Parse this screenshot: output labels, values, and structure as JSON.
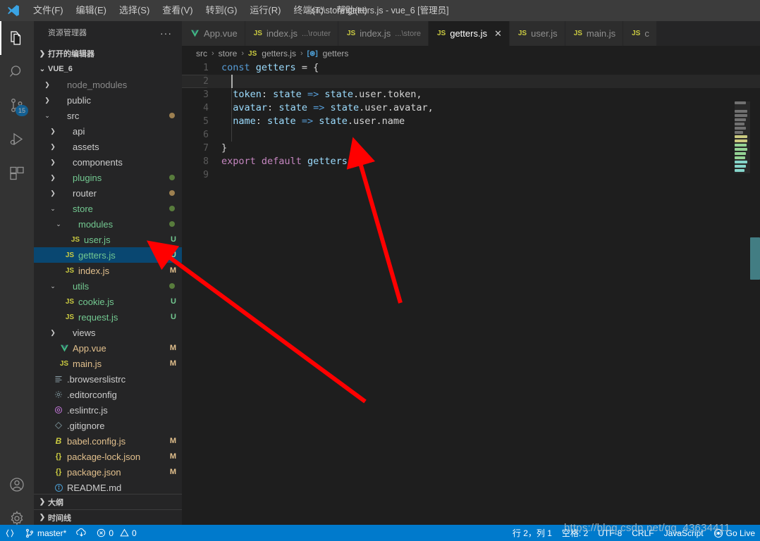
{
  "window": {
    "title": "src\\store\\getters.js - vue_6 [管理员]",
    "logo_icon": "vscode-logo"
  },
  "menu": {
    "items": [
      {
        "label": "文件(F)",
        "name": "menu-file"
      },
      {
        "label": "编辑(E)",
        "name": "menu-edit"
      },
      {
        "label": "选择(S)",
        "name": "menu-selection"
      },
      {
        "label": "查看(V)",
        "name": "menu-view"
      },
      {
        "label": "转到(G)",
        "name": "menu-goto"
      },
      {
        "label": "运行(R)",
        "name": "menu-run"
      },
      {
        "label": "终端(T)",
        "name": "menu-terminal"
      },
      {
        "label": "帮助(H)",
        "name": "menu-help"
      }
    ]
  },
  "activitybar": {
    "items": [
      {
        "icon": "files-explorer-icon",
        "active": true,
        "badge": ""
      },
      {
        "icon": "search-icon",
        "active": false,
        "badge": ""
      },
      {
        "icon": "source-control-icon",
        "active": false,
        "badge": "15"
      },
      {
        "icon": "run-debug-icon",
        "active": false,
        "badge": ""
      },
      {
        "icon": "extensions-icon",
        "active": false,
        "badge": ""
      }
    ],
    "bottom": [
      {
        "icon": "account-icon"
      },
      {
        "icon": "gear-icon"
      }
    ]
  },
  "sidebar": {
    "title": "资源管理器",
    "more_actions": "···",
    "open_editors_label": "打开的编辑器",
    "project_label": "VUE_6",
    "outline_label": "大纲",
    "timeline_label": "时间线",
    "tree": [
      {
        "label": "node_modules",
        "type": "folder",
        "depth": 1,
        "expanded": false,
        "badge": "",
        "dot": "",
        "color": "#8a8a8a"
      },
      {
        "label": "public",
        "type": "folder",
        "depth": 1,
        "expanded": false,
        "badge": "",
        "dot": "",
        "color": "#cccccc"
      },
      {
        "label": "src",
        "type": "folder",
        "depth": 1,
        "expanded": true,
        "badge": "",
        "dot": "#9d8050",
        "color": "#cccccc"
      },
      {
        "label": "api",
        "type": "folder",
        "depth": 2,
        "expanded": false,
        "badge": "",
        "dot": "",
        "color": "#cccccc"
      },
      {
        "label": "assets",
        "type": "folder",
        "depth": 2,
        "expanded": false,
        "badge": "",
        "dot": "",
        "color": "#cccccc"
      },
      {
        "label": "components",
        "type": "folder",
        "depth": 2,
        "expanded": false,
        "badge": "",
        "dot": "",
        "color": "#cccccc"
      },
      {
        "label": "plugins",
        "type": "folder",
        "depth": 2,
        "expanded": false,
        "badge": "",
        "dot": "#587c3c",
        "color": "#73c991"
      },
      {
        "label": "router",
        "type": "folder",
        "depth": 2,
        "expanded": false,
        "badge": "",
        "dot": "#9d8050",
        "color": "#cccccc"
      },
      {
        "label": "store",
        "type": "folder",
        "depth": 2,
        "expanded": true,
        "badge": "",
        "dot": "#587c3c",
        "color": "#73c991"
      },
      {
        "label": "modules",
        "type": "folder",
        "depth": 3,
        "expanded": true,
        "badge": "",
        "dot": "#587c3c",
        "color": "#73c991"
      },
      {
        "label": "user.js",
        "type": "js",
        "depth": 4,
        "expanded": false,
        "badge": "U",
        "dot": "",
        "color": "#73c991"
      },
      {
        "label": "getters.js",
        "type": "js",
        "depth": 3,
        "expanded": false,
        "badge": "U",
        "dot": "",
        "color": "#73c991",
        "selected": true
      },
      {
        "label": "index.js",
        "type": "js",
        "depth": 3,
        "expanded": false,
        "badge": "M",
        "dot": "",
        "color": "#e2c08d"
      },
      {
        "label": "utils",
        "type": "folder",
        "depth": 2,
        "expanded": true,
        "badge": "",
        "dot": "#587c3c",
        "color": "#73c991"
      },
      {
        "label": "cookie.js",
        "type": "js",
        "depth": 3,
        "expanded": false,
        "badge": "U",
        "dot": "",
        "color": "#73c991"
      },
      {
        "label": "request.js",
        "type": "js",
        "depth": 3,
        "expanded": false,
        "badge": "U",
        "dot": "",
        "color": "#73c991"
      },
      {
        "label": "views",
        "type": "folder",
        "depth": 2,
        "expanded": false,
        "badge": "",
        "dot": "",
        "color": "#cccccc"
      },
      {
        "label": "App.vue",
        "type": "vue",
        "depth": 2,
        "expanded": false,
        "badge": "M",
        "dot": "",
        "color": "#e2c08d"
      },
      {
        "label": "main.js",
        "type": "js",
        "depth": 2,
        "expanded": false,
        "badge": "M",
        "dot": "",
        "color": "#e2c08d"
      },
      {
        "label": ".browserslistrc",
        "type": "config",
        "depth": 1,
        "expanded": false,
        "badge": "",
        "dot": "",
        "color": "#cccccc"
      },
      {
        "label": ".editorconfig",
        "type": "gear",
        "depth": 1,
        "expanded": false,
        "badge": "",
        "dot": "",
        "color": "#cccccc"
      },
      {
        "label": ".eslintrc.js",
        "type": "eslint",
        "depth": 1,
        "expanded": false,
        "badge": "",
        "dot": "",
        "color": "#cccccc"
      },
      {
        "label": ".gitignore",
        "type": "git",
        "depth": 1,
        "expanded": false,
        "badge": "",
        "dot": "",
        "color": "#cccccc"
      },
      {
        "label": "babel.config.js",
        "type": "babel",
        "depth": 1,
        "expanded": false,
        "badge": "M",
        "dot": "",
        "color": "#e2c08d"
      },
      {
        "label": "package-lock.json",
        "type": "json",
        "depth": 1,
        "expanded": false,
        "badge": "M",
        "dot": "",
        "color": "#e2c08d"
      },
      {
        "label": "package.json",
        "type": "json",
        "depth": 1,
        "expanded": false,
        "badge": "M",
        "dot": "",
        "color": "#e2c08d"
      },
      {
        "label": "README.md",
        "type": "info",
        "depth": 1,
        "expanded": false,
        "badge": "",
        "dot": "",
        "color": "#cccccc"
      }
    ]
  },
  "editor": {
    "tabs": [
      {
        "label": "App.vue",
        "sub": "",
        "icon": "vue-icon",
        "active": false,
        "close": false
      },
      {
        "label": "index.js",
        "sub": "...\\router",
        "icon": "js-icon",
        "active": false,
        "close": false
      },
      {
        "label": "index.js",
        "sub": "...\\store",
        "icon": "js-icon",
        "active": false,
        "close": false
      },
      {
        "label": "getters.js",
        "sub": "",
        "icon": "js-icon",
        "active": true,
        "close": true
      },
      {
        "label": "user.js",
        "sub": "",
        "icon": "js-icon",
        "active": false,
        "close": false
      },
      {
        "label": "main.js",
        "sub": "",
        "icon": "js-icon",
        "active": false,
        "close": false
      },
      {
        "label": "c",
        "sub": "",
        "icon": "js-icon",
        "active": false,
        "close": false
      }
    ],
    "close_label": "✕",
    "breadcrumb": [
      {
        "label": "src",
        "icon": ""
      },
      {
        "label": "store",
        "icon": ""
      },
      {
        "label": "getters.js",
        "icon": "js-icon"
      },
      {
        "label": "getters",
        "icon": "symbol-object-icon"
      }
    ],
    "breadcrumb_separator": "›",
    "lines": [
      {
        "n": "1",
        "segments": [
          {
            "t": "const",
            "c": "kw"
          },
          {
            "t": " ",
            "c": "op"
          },
          {
            "t": "getters",
            "c": "ident"
          },
          {
            "t": " = ",
            "c": "op"
          },
          {
            "t": "{",
            "c": "brk"
          }
        ]
      },
      {
        "n": "2",
        "segments": [],
        "current": true
      },
      {
        "n": "3",
        "segments": [
          {
            "t": "  ",
            "c": "op"
          },
          {
            "t": "token",
            "c": "prop"
          },
          {
            "t": ": ",
            "c": "op"
          },
          {
            "t": "state",
            "c": "ident"
          },
          {
            "t": " => ",
            "c": "kw"
          },
          {
            "t": "state",
            "c": "ident"
          },
          {
            "t": ".user.token",
            "c": "op"
          },
          {
            "t": ",",
            "c": "op"
          }
        ]
      },
      {
        "n": "4",
        "segments": [
          {
            "t": "  ",
            "c": "op"
          },
          {
            "t": "avatar",
            "c": "prop"
          },
          {
            "t": ": ",
            "c": "op"
          },
          {
            "t": "state",
            "c": "ident"
          },
          {
            "t": " => ",
            "c": "kw"
          },
          {
            "t": "state",
            "c": "ident"
          },
          {
            "t": ".user.avatar",
            "c": "op"
          },
          {
            "t": ",",
            "c": "op"
          }
        ]
      },
      {
        "n": "5",
        "segments": [
          {
            "t": "  ",
            "c": "op"
          },
          {
            "t": "name",
            "c": "prop"
          },
          {
            "t": ": ",
            "c": "op"
          },
          {
            "t": "state",
            "c": "ident"
          },
          {
            "t": " => ",
            "c": "kw"
          },
          {
            "t": "state",
            "c": "ident"
          },
          {
            "t": ".user.name",
            "c": "op"
          }
        ]
      },
      {
        "n": "6",
        "segments": []
      },
      {
        "n": "7",
        "segments": [
          {
            "t": "}",
            "c": "brk"
          }
        ]
      },
      {
        "n": "8",
        "segments": [
          {
            "t": "export",
            "c": "kw2"
          },
          {
            "t": " ",
            "c": "op"
          },
          {
            "t": "default",
            "c": "kw2"
          },
          {
            "t": " ",
            "c": "op"
          },
          {
            "t": "getters",
            "c": "ident"
          }
        ]
      },
      {
        "n": "9",
        "segments": []
      }
    ]
  },
  "statusbar": {
    "left": [
      {
        "icon": "remote-icon",
        "label": "",
        "name": "remote-indicator"
      },
      {
        "icon": "source-control-branch-icon",
        "label": "master*",
        "name": "branch-status"
      },
      {
        "icon": "sync-icon",
        "label": "",
        "name": "sync-status"
      },
      {
        "icon": "error-icon",
        "label": "0",
        "name": "error-count"
      },
      {
        "icon": "warning-icon",
        "label": "0",
        "name": "warning-count"
      }
    ],
    "right": [
      {
        "icon": "",
        "label": "行 2，列 1",
        "name": "cursor-position"
      },
      {
        "icon": "",
        "label": "空格: 2",
        "name": "indentation"
      },
      {
        "icon": "",
        "label": "UTF-8",
        "name": "encoding"
      },
      {
        "icon": "",
        "label": "CRLF",
        "name": "eol"
      },
      {
        "icon": "",
        "label": "JavaScript",
        "name": "language-mode"
      },
      {
        "icon": "broadcast-icon",
        "label": "Go Live",
        "name": "go-live"
      }
    ]
  },
  "watermark": {
    "text": "https://blog.csdn.net/qq_43634411"
  },
  "colors": {
    "accent": "#007acc",
    "selection": "#094771",
    "untracked": "#73c991",
    "modified": "#e2c08d",
    "arrow": "#ff0000"
  }
}
